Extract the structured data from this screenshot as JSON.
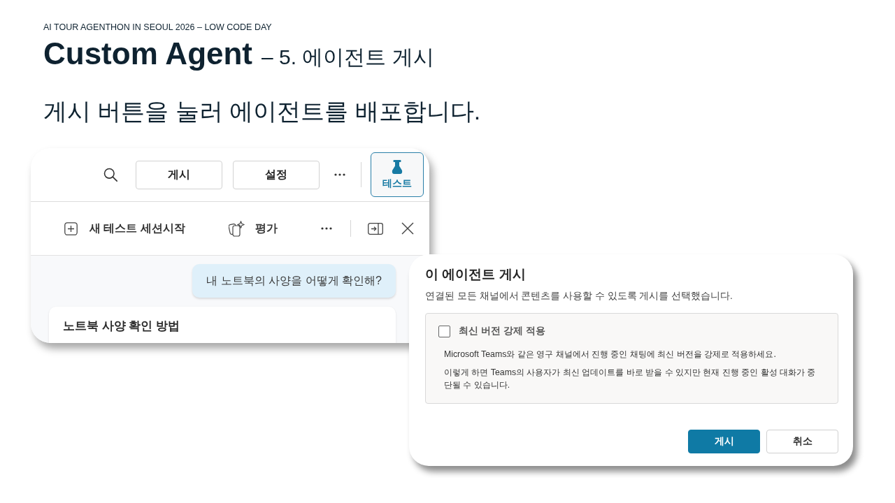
{
  "header": {
    "event": "AI TOUR AGENTHON IN SEOUL 2026 – LOW CODE DAY",
    "title": "Custom Agent",
    "subtitle": "– 5. 에이전트 게시"
  },
  "headline": "게시 버튼을 눌러 에이전트를 배포합니다.",
  "agent_panel": {
    "toolbar_buttons": [
      {
        "label": "게시"
      },
      {
        "label": "설정"
      }
    ],
    "test_button": {
      "label": "테스트",
      "selected": true
    },
    "test_bar": {
      "new_session": "새 테스트 세션시작",
      "evaluate": "평가"
    },
    "chat": {
      "user_message": "내 노트북의 사양을 어떻게 확인해?",
      "response_title": "노트북 사양 확인 방법"
    }
  },
  "dialog": {
    "title": "이 에이전트 게시",
    "description": "연결된 모든 채널에서 콘텐츠를 사용할 수 있도록 게시를 선택했습니다.",
    "option": {
      "label": "최신 버전 강제 적용",
      "checked": false,
      "details": [
        "Microsoft Teams와 같은 영구 채널에서 진행 중인 채팅에 최신 버전을 강제로 적용하세요.",
        "이렇게 하면 Teams의 사용자가 최신 업데이트를 바로 받을 수 있지만 현재 진행 중인 활성 대화가 중단될 수 있습니다."
      ]
    },
    "buttons": [
      {
        "label": "게시",
        "kind": "primary"
      },
      {
        "label": "취소",
        "kind": "secondary"
      }
    ]
  }
}
